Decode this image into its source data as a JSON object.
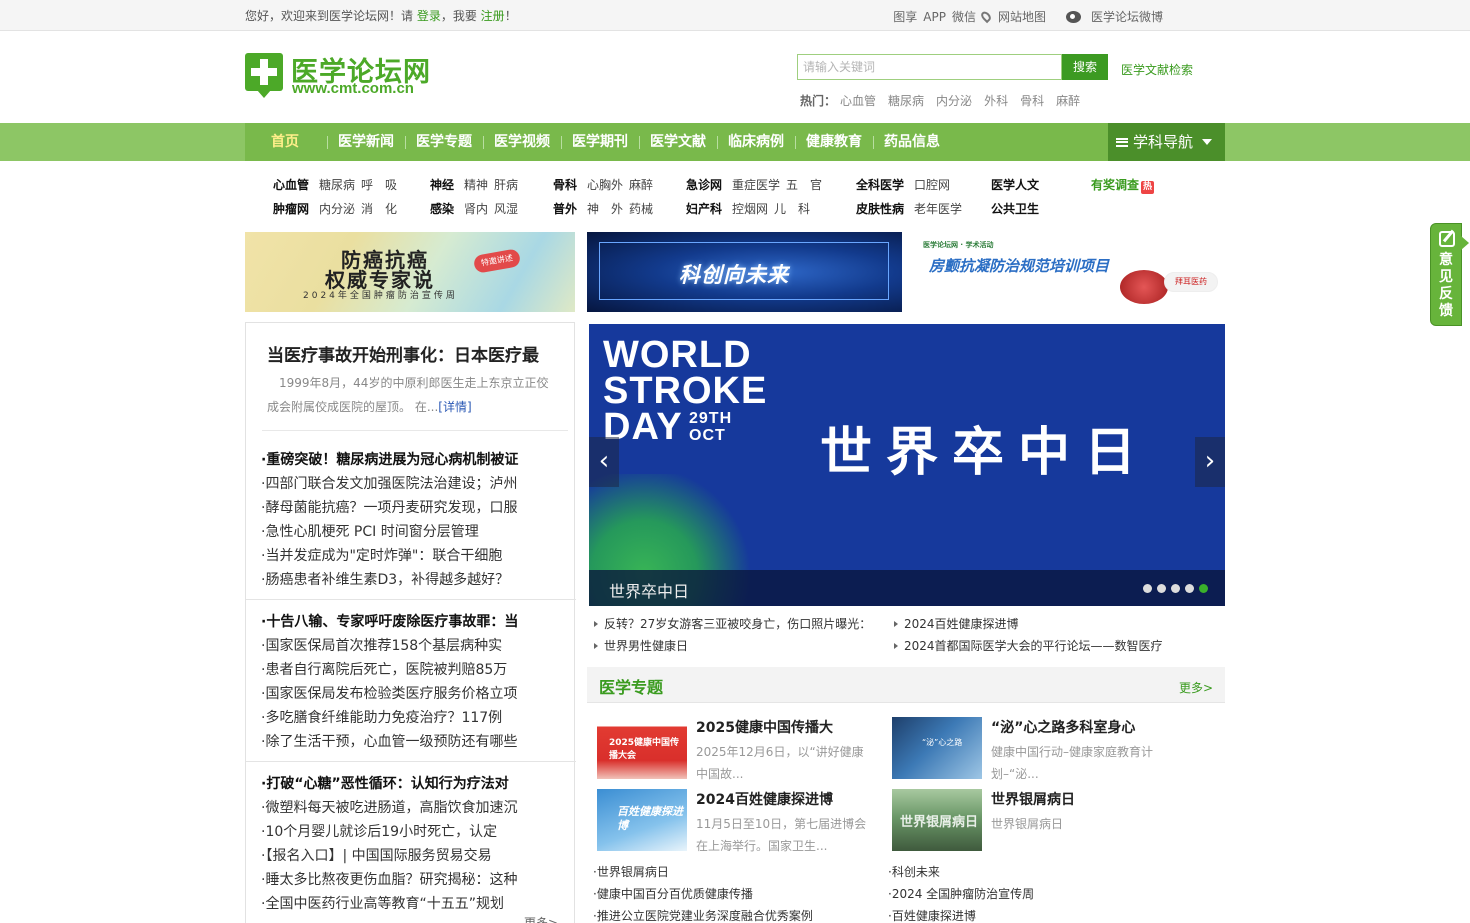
{
  "topbar": {
    "welcome_prefix": "您好，欢迎来到医学论坛网！请 ",
    "login": "登录",
    "welcome_mid": "，我要 ",
    "register": "注册",
    "welcome_suffix": "！",
    "links": [
      "图享",
      "APP",
      "微信"
    ],
    "sitemap": "网站地图",
    "weibo": "医学论坛微博"
  },
  "logo": {
    "name": "医学论坛网",
    "url": "www.cmt.com.cn"
  },
  "search": {
    "placeholder": "请输入关键词",
    "button": "搜索",
    "literature": "医学文献检索",
    "hot_label": "热门：",
    "hot": [
      "心血管",
      "糖尿病",
      "内分泌",
      "外科",
      "骨科",
      "麻醉"
    ]
  },
  "nav": {
    "items": [
      "首页",
      "医学新闻",
      "医学专题",
      "医学视频",
      "医学期刊",
      "医学文献",
      "临床病例",
      "健康教育",
      "药品信息"
    ],
    "subject_nav": "学科导航"
  },
  "categories": {
    "c1": {
      "r1_head": "心血管",
      "r1": [
        "糖尿病",
        "呼　吸"
      ],
      "r2_head": "肿瘤网",
      "r2": [
        "内分泌",
        "消　化"
      ]
    },
    "c2": {
      "r1_head": "神经",
      "r1": [
        "精神",
        "肝病"
      ],
      "r2_head": "感染",
      "r2": [
        "肾内",
        "风湿"
      ]
    },
    "c3": {
      "r1_head": "骨科",
      "r1": [
        "心胸外",
        "麻醉"
      ],
      "r2_head": "普外",
      "r2": [
        "神　外",
        "药械"
      ]
    },
    "c4": {
      "r1_head": "急诊网",
      "r1": [
        "重症医学",
        "五　官"
      ],
      "r2_head": "妇产科",
      "r2": [
        "控烟网",
        "儿　科"
      ]
    },
    "c5": {
      "r1_head": "全科医学",
      "r1": [
        "口腔网"
      ],
      "r2_head": "皮肤性病",
      "r2": [
        "老年医学"
      ]
    },
    "c6": {
      "r1_head": "医学人文",
      "r2_head": "公共卫生"
    },
    "survey": "有奖调查",
    "survey_badge": "热"
  },
  "banners": {
    "b1_line1": "防癌抗癌",
    "b1_line2": "权威专家说",
    "b1_line3": "2024年全国肿瘤防治宣传周",
    "b1_seal": "特邀讲述",
    "b2_text": "科创向未来",
    "b3_logo": "医学论坛网 · 学术活动",
    "b3_text": "房颤抗凝防治规范培训项目",
    "b3_badge": "拜耳医药"
  },
  "lead": {
    "title": "当医疗事故开始刑事化：日本医疗最",
    "summary": "1999年8月，44岁的中原利郎医生走上东京立正佼成会附属佼成医院的屋顶。 在...",
    "more": "[详情]"
  },
  "news_lists": [
    [
      "·重磅突破！糖尿病进展为冠心病机制被证",
      "·四部门联合发文加强医院法治建设；泸州",
      "·酵母菌能抗癌？一项丹麦研究发现，口服",
      "·急性心肌梗死 PCI 时间窗分层管理",
      "·当并发症成为\"定时炸弹\"：联合干细胞",
      "·肠癌患者补维生素D3，补得越多越好？"
    ],
    [
      "·十告八输、专家呼吁废除医疗事故罪：当",
      "·国家医保局首次推荐158个基层病种实",
      "·患者自行离院后死亡，医院被判赔85万",
      "·国家医保局发布检验类医疗服务价格立项",
      "·多吃膳食纤维能助力免疫治疗？117例",
      "·除了生活干预，心血管一级预防还有哪些"
    ],
    [
      "·打破“心糖”恶性循环：认知行为疗法对",
      "·微塑料每天被吃进肠道，高脂饮食加速沉",
      "·10个月婴儿就诊后19小时死亡，认定",
      "·【报名入口】| 中国国际服务贸易交易",
      "·睡太多比熬夜更伤血脂？研究揭秘：这种",
      "·全国中医药行业高等教育“十五五”规划"
    ]
  ],
  "left_more": "更多>",
  "slider": {
    "en_line1": "WORLD",
    "en_line2": "STROKE",
    "en_line3": "DAY",
    "date": "29TH OCT",
    "cn_title": "世界卒中日",
    "caption": "世界卒中日",
    "slide_count": 5,
    "active_slide": 5
  },
  "headlines": [
    "反转？27岁女游客三亚被咬身亡，伤口照片曝光：",
    "2024百姓健康探进博",
    "世界男性健康日",
    "2024首都国际医学大会的平行论坛——数智医疗"
  ],
  "topics": {
    "title": "医学专题",
    "more": "更多>",
    "cards": [
      {
        "title": "2025健康中国传播大",
        "desc": "2025年12月6日，以“讲好健康中国故...",
        "img_text": "2025健康中国传播大会"
      },
      {
        "title": "“泌”心之路多科室身心",
        "desc": "健康中国行动–健康家庭教育计划–“泌...",
        "img_text": "“泌”心之路"
      },
      {
        "title": "2024百姓健康探进博",
        "desc": "11月5日至10日，第七届进博会在上海举行。国家卫生...",
        "img_text": "百姓健康探进博"
      },
      {
        "title": "世界银屑病日",
        "desc": "世界银屑病日",
        "img_text": "世界银屑病日"
      }
    ],
    "list_left": [
      "·世界银屑病日",
      "·健康中国百分百优质健康传播",
      "·推进公立医院党建业务深度融合优秀案例"
    ],
    "list_right": [
      "·科创未来",
      "·2024 全国肿瘤防治宣传周",
      "·百姓健康探进博"
    ]
  },
  "feedback": "意见反馈",
  "colors": {
    "brand_green": "#4ca928",
    "nav_green": "#79b94b",
    "slider_blue": "#16399c"
  }
}
